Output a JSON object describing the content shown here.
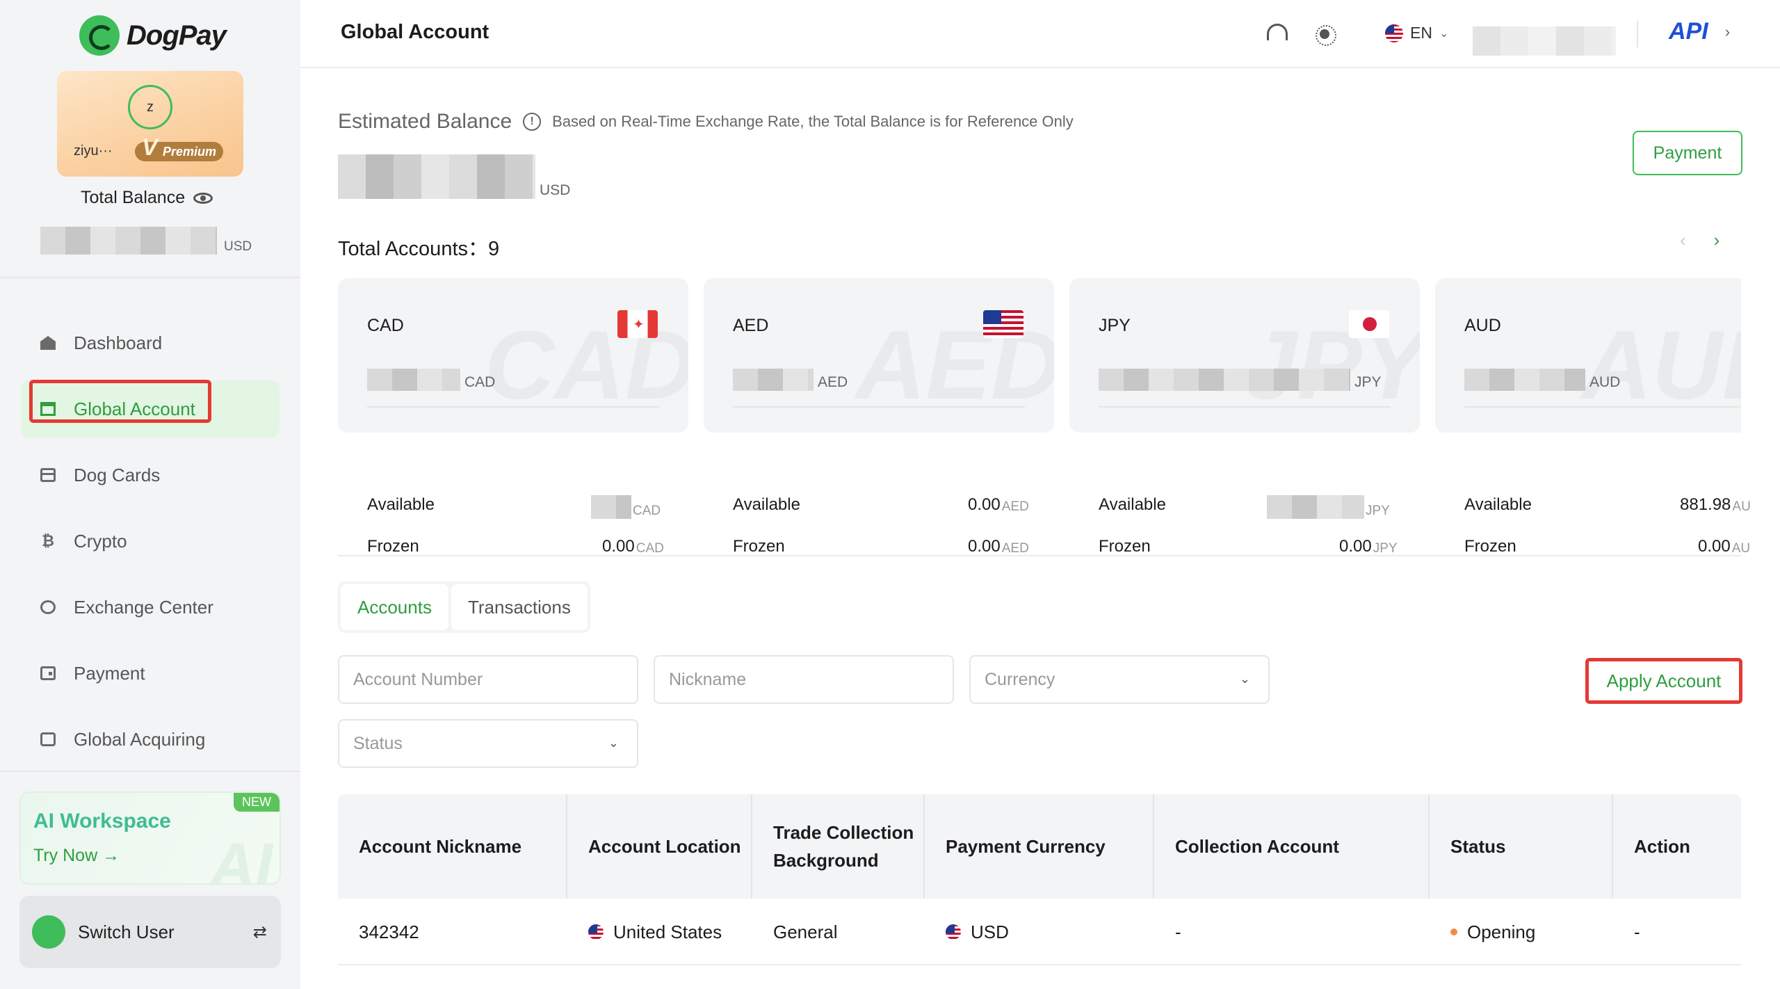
{
  "brand": {
    "name": "DogPay"
  },
  "sidebar": {
    "user": {
      "avatar_initial": "z",
      "name": "ziyu···",
      "badge": "Premium"
    },
    "total_balance_label": "Total Balance",
    "balance_unit": "USD",
    "nav": [
      {
        "label": "Dashboard",
        "icon": "home-icon",
        "active": false
      },
      {
        "label": "Global Account",
        "icon": "bank-icon",
        "active": true
      },
      {
        "label": "Dog Cards",
        "icon": "card-icon",
        "active": false
      },
      {
        "label": "Crypto",
        "icon": "bitcoin-icon",
        "active": false
      },
      {
        "label": "Exchange Center",
        "icon": "exchange-icon",
        "active": false
      },
      {
        "label": "Payment",
        "icon": "wallet-icon",
        "active": false
      },
      {
        "label": "Global Acquiring",
        "icon": "acquiring-icon",
        "active": false
      }
    ],
    "ai_workspace": {
      "title": "AI Workspace",
      "cta": "Try Now →",
      "badge": "NEW"
    },
    "switch_user": {
      "label": "Switch User",
      "icon": "swap-icon"
    }
  },
  "header": {
    "title": "Global Account",
    "language": "EN",
    "api_label": "API"
  },
  "main": {
    "estimated_balance": {
      "title": "Estimated Balance",
      "note": "Based on Real-Time Exchange Rate, the Total Balance is for Reference Only",
      "unit": "USD"
    },
    "payment_button": "Payment",
    "total_accounts": {
      "label": "Total Accounts：",
      "count": "9"
    },
    "accounts": [
      {
        "currency": "CAD",
        "available": "",
        "frozen": "0.00",
        "unit": "CAD",
        "flag": "canada-flag-icon"
      },
      {
        "currency": "AED",
        "available": "0.00",
        "frozen": "0.00",
        "unit": "AED",
        "flag": "us-flag-icon"
      },
      {
        "currency": "JPY",
        "available": "",
        "frozen": "0.00",
        "unit": "JPY",
        "flag": "japan-flag-icon"
      },
      {
        "currency": "AUD",
        "available": "881.98",
        "frozen": "0.00",
        "unit": "AU",
        "flag": "australia-flag-icon"
      }
    ],
    "labels": {
      "available": "Available",
      "frozen": "Frozen"
    },
    "tabs": [
      {
        "label": "Accounts",
        "active": true
      },
      {
        "label": "Transactions",
        "active": false
      }
    ],
    "filters": {
      "account_number_placeholder": "Account Number",
      "nickname_placeholder": "Nickname",
      "currency_placeholder": "Currency",
      "status_placeholder": "Status"
    },
    "apply_button": "Apply Account",
    "table": {
      "columns": [
        "Account Nickname",
        "Account Location",
        "Trade Collection Background",
        "Payment Currency",
        "Collection Account",
        "Status",
        "Action"
      ],
      "rows": [
        {
          "nickname": "342342",
          "location": "United States",
          "background": "General",
          "currency": "USD",
          "collection_account": "-",
          "status": "Opening",
          "action": "-"
        }
      ]
    }
  }
}
